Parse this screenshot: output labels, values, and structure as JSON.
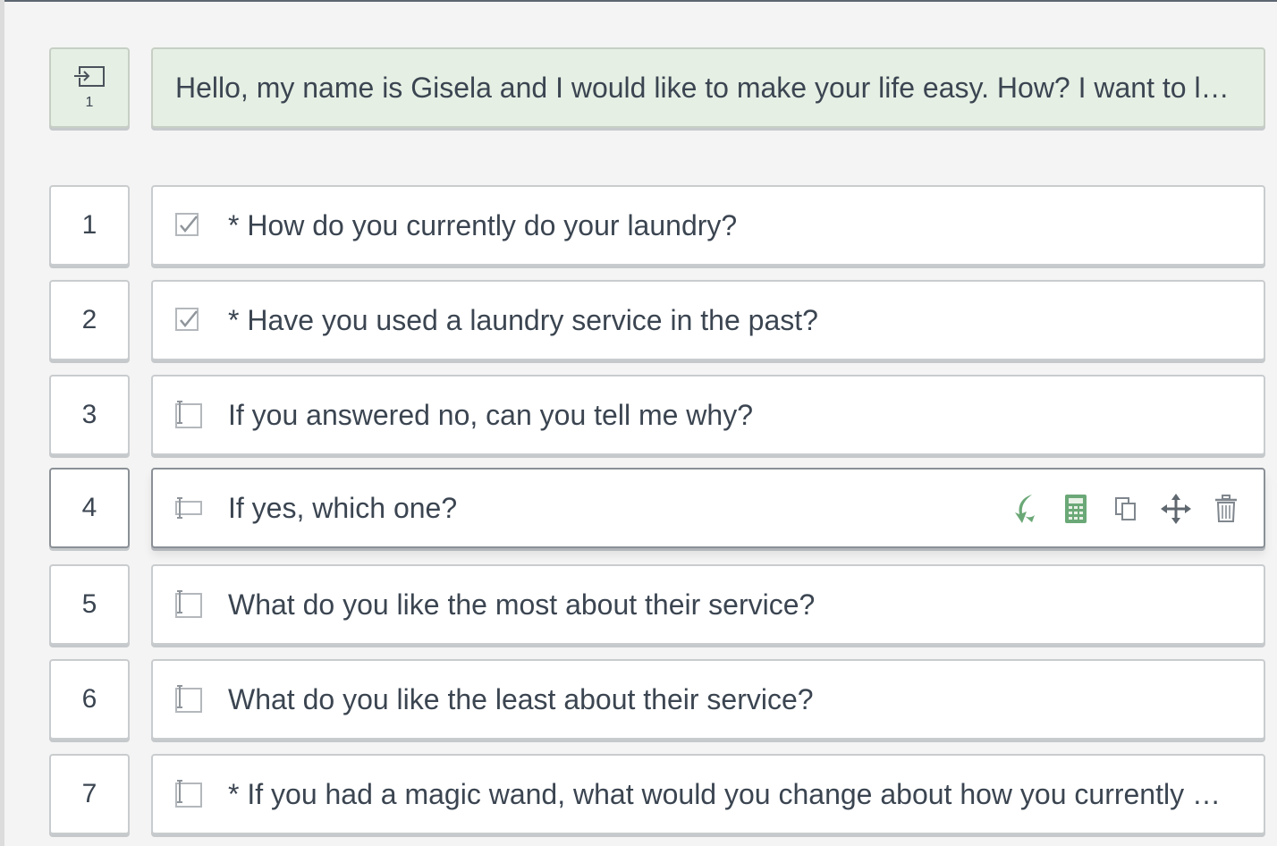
{
  "intro": {
    "number": "1",
    "text": "Hello, my name is Gisela and I would like to make your life easy. How? I want to learn more about how you do your laundry"
  },
  "questions": [
    {
      "number": "1",
      "icon": "checkbox-icon",
      "text": "* How do you currently do your laundry?"
    },
    {
      "number": "2",
      "icon": "checkbox-icon",
      "text": "* Have you used a laundry service in the past?"
    },
    {
      "number": "3",
      "icon": "textbox-icon",
      "text": "If you answered no, can you tell me why?"
    },
    {
      "number": "4",
      "icon": "textline-icon",
      "text": "If yes, which one?"
    },
    {
      "number": "5",
      "icon": "textbox-icon",
      "text": "What do you like the most about their service?"
    },
    {
      "number": "6",
      "icon": "textbox-icon",
      "text": "What do you like the least about their service?"
    },
    {
      "number": "7",
      "icon": "textbox-icon",
      "text": "* If you had a magic wand, what would you change about how you currently do your laundry?"
    }
  ],
  "toolbar": {
    "icons": [
      "logic-icon",
      "calculator-icon",
      "duplicate-icon",
      "move-icon",
      "trash-icon"
    ]
  },
  "colors": {
    "intro_background": "#e6efe4",
    "accent_green": "#6ba877",
    "border": "#c9ccce",
    "text": "#3b4551"
  }
}
